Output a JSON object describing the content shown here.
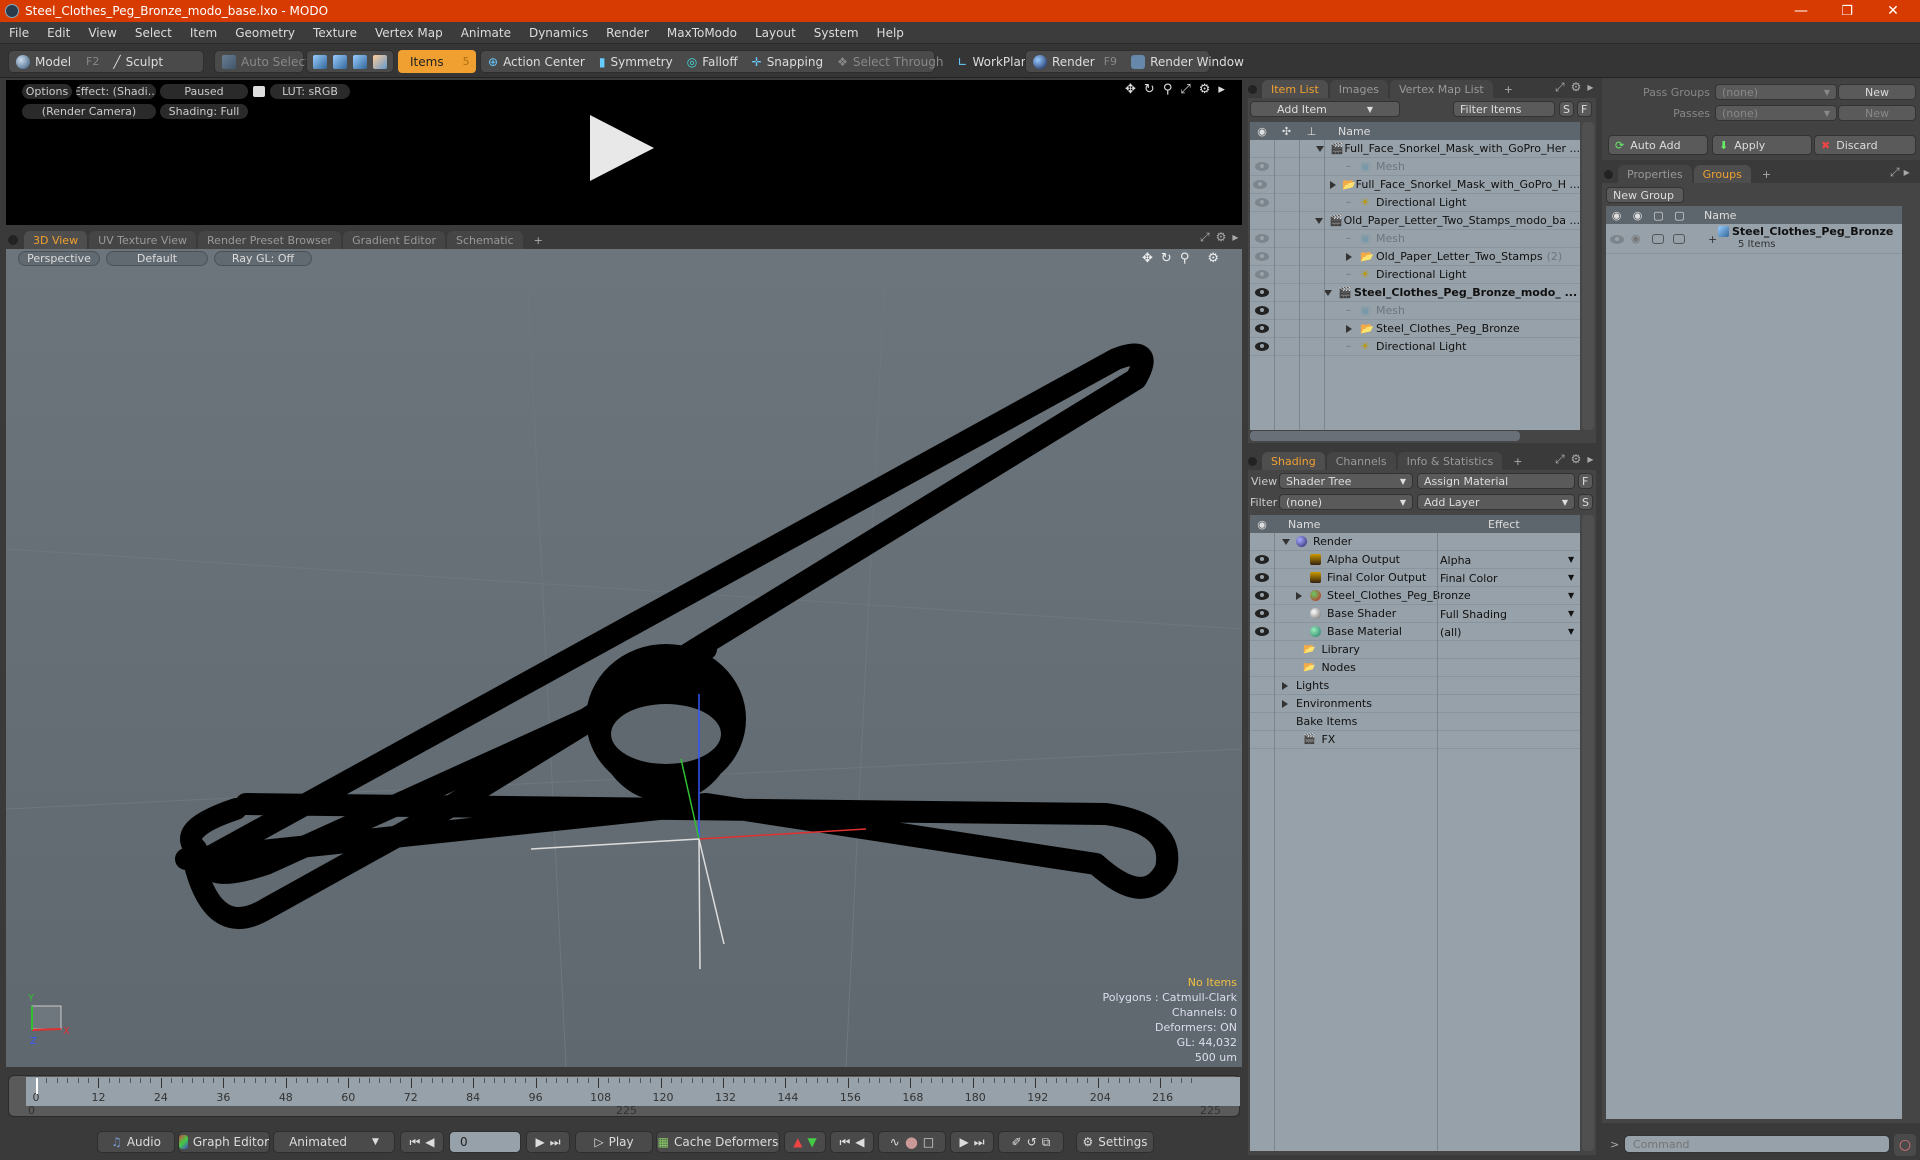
{
  "window": {
    "title": "Steel_Clothes_Peg_Bronze_modo_base.lxo - MODO",
    "minimize_icon": "minimize-icon",
    "maximize_icon": "restore-icon",
    "close_icon": "close-icon"
  },
  "menu": [
    "File",
    "Edit",
    "View",
    "Select",
    "Item",
    "Geometry",
    "Texture",
    "Vertex Map",
    "Animate",
    "Dynamics",
    "Render",
    "MaxToModo",
    "Layout",
    "System",
    "Help"
  ],
  "toolbar": {
    "model": "Model",
    "model_key": "F2",
    "sculpt": "Sculpt",
    "auto_select": "Auto Select",
    "items": "Items",
    "items_key": "5",
    "action_center": "Action Center",
    "symmetry": "Symmetry",
    "falloff": "Falloff",
    "snapping": "Snapping",
    "select_through": "Select Through",
    "workplane": "WorkPlane",
    "render": "Render",
    "render_key": "F9",
    "render_window": "Render Window"
  },
  "preview": {
    "options": "Options",
    "effect": "Effect: (Shadi...",
    "paused": "Paused",
    "lut": "LUT: sRGB",
    "camera": "(Render Camera)",
    "shading": "Shading: Full"
  },
  "viewport_tabs": [
    "3D View",
    "UV Texture View",
    "Render Preset Browser",
    "Gradient Editor",
    "Schematic"
  ],
  "viewport": {
    "perspective": "Perspective",
    "default": "Default",
    "raygl": "Ray GL: Off",
    "stats": {
      "selection": "No Items",
      "polygons": "Polygons : Catmull-Clark",
      "channels": "Channels: 0",
      "deformers": "Deformers: ON",
      "gl": "GL: 44,032",
      "scale": "500 um"
    },
    "colors": {
      "selection": "#f0c040"
    }
  },
  "item_list": {
    "tabs": [
      "Item List",
      "Images",
      "Vertex Map List"
    ],
    "add_item": "Add Item",
    "filter": "Filter Items",
    "s": "S",
    "f": "F",
    "name_header": "Name",
    "rows": [
      {
        "label": "Full_Face_Snorkel_Mask_with_GoPro_Her ...",
        "level": 0,
        "type": "scene",
        "eye": false,
        "expand": "down"
      },
      {
        "label": "Mesh",
        "level": 1,
        "type": "mesh",
        "eye": "dim",
        "dim": true
      },
      {
        "label": "Full_Face_Snorkel_Mask_with_GoPro_H ...",
        "level": 1,
        "type": "folder",
        "eye": "dim",
        "expand": "right"
      },
      {
        "label": "Directional Light",
        "level": 1,
        "type": "light",
        "eye": "dim"
      },
      {
        "label": "Old_Paper_Letter_Two_Stamps_modo_ba ...",
        "level": 0,
        "type": "scene",
        "eye": false,
        "expand": "down"
      },
      {
        "label": "Mesh",
        "level": 1,
        "type": "mesh",
        "eye": "dim",
        "dim": true
      },
      {
        "label": "Old_Paper_Letter_Two_Stamps",
        "suffix": "(2)",
        "level": 1,
        "type": "folder",
        "eye": "dim",
        "expand": "right"
      },
      {
        "label": "Directional Light",
        "level": 1,
        "type": "light",
        "eye": "dim"
      },
      {
        "label": "Steel_Clothes_Peg_Bronze_modo_ ...",
        "level": 0,
        "type": "scene",
        "eye": true,
        "expand": "down",
        "bold": true
      },
      {
        "label": "Mesh",
        "level": 1,
        "type": "mesh",
        "eye": true,
        "dim": true
      },
      {
        "label": "Steel_Clothes_Peg_Bronze",
        "level": 1,
        "type": "folder",
        "eye": true,
        "expand": "right"
      },
      {
        "label": "Directional Light",
        "level": 1,
        "type": "light",
        "eye": true
      }
    ]
  },
  "shading": {
    "tabs": [
      "Shading",
      "Channels",
      "Info & Statistics"
    ],
    "view_label": "View",
    "view_value": "Shader Tree",
    "assign": "Assign Material",
    "f": "F",
    "filter_label": "Filter",
    "filter_value": "(none)",
    "add_layer": "Add Layer",
    "s": "S",
    "name_header": "Name",
    "effect_header": "Effect",
    "rows": [
      {
        "label": "Render",
        "effect": "",
        "level": 0,
        "icon": "render-sphere",
        "eye": false,
        "expand": "down"
      },
      {
        "label": "Alpha Output",
        "effect": "Alpha",
        "level": 1,
        "icon": "output",
        "eye": true,
        "dropdown": true
      },
      {
        "label": "Final Color Output",
        "effect": "Final Color",
        "level": 1,
        "icon": "output",
        "eye": true,
        "dropdown": true
      },
      {
        "label": "Steel_Clothes_Peg_Bronze",
        "effect": "",
        "level": 1,
        "icon": "material-group",
        "eye": true,
        "dropdown": true,
        "expand": "right"
      },
      {
        "label": "Base Shader",
        "effect": "Full Shading",
        "level": 1,
        "icon": "shader",
        "eye": true,
        "dropdown": true
      },
      {
        "label": "Base Material",
        "effect": "(all)",
        "level": 1,
        "icon": "material",
        "eye": true,
        "dropdown": true
      },
      {
        "label": "Library",
        "effect": "",
        "level": 0.5,
        "icon": "folder",
        "eye": false
      },
      {
        "label": "Nodes",
        "effect": "",
        "level": 0.5,
        "icon": "folder",
        "eye": false
      },
      {
        "label": "Lights",
        "effect": "",
        "level": 0,
        "icon": "",
        "eye": false,
        "expand": "right"
      },
      {
        "label": "Environments",
        "effect": "",
        "level": 0,
        "icon": "",
        "eye": false,
        "expand": "right"
      },
      {
        "label": "Bake Items",
        "effect": "",
        "level": 0,
        "icon": "",
        "eye": false
      },
      {
        "label": "FX",
        "effect": "",
        "level": 0.5,
        "icon": "clapper",
        "eye": false
      }
    ]
  },
  "passes": {
    "pass_groups_label": "Pass Groups",
    "pass_groups_value": "(none)",
    "passes_label": "Passes",
    "passes_value": "(none)",
    "new": "New",
    "auto_add": "Auto Add",
    "apply": "Apply",
    "discard": "Discard"
  },
  "groups": {
    "tabs": [
      "Properties",
      "Groups"
    ],
    "new_group": "New Group",
    "name_header": "Name",
    "rows": [
      {
        "label": "Steel_Clothes_Peg_Bronze",
        "sub": "5 Items"
      }
    ]
  },
  "timeline": {
    "ticks": [
      "0",
      "12",
      "24",
      "36",
      "48",
      "60",
      "72",
      "84",
      "96",
      "108",
      "120",
      "132",
      "144",
      "156",
      "168",
      "180",
      "192",
      "204",
      "216"
    ],
    "range_start": "0",
    "range_end": "225",
    "range_end2": "225",
    "current_frame": 0
  },
  "bottombar": {
    "audio": "Audio",
    "graph_editor": "Graph Editor",
    "animated": "Animated",
    "frame": "0",
    "play": "Play",
    "cache_deformers": "Cache Deformers",
    "settings": "Settings"
  },
  "command": {
    "prompt": ">",
    "placeholder": "Command"
  }
}
